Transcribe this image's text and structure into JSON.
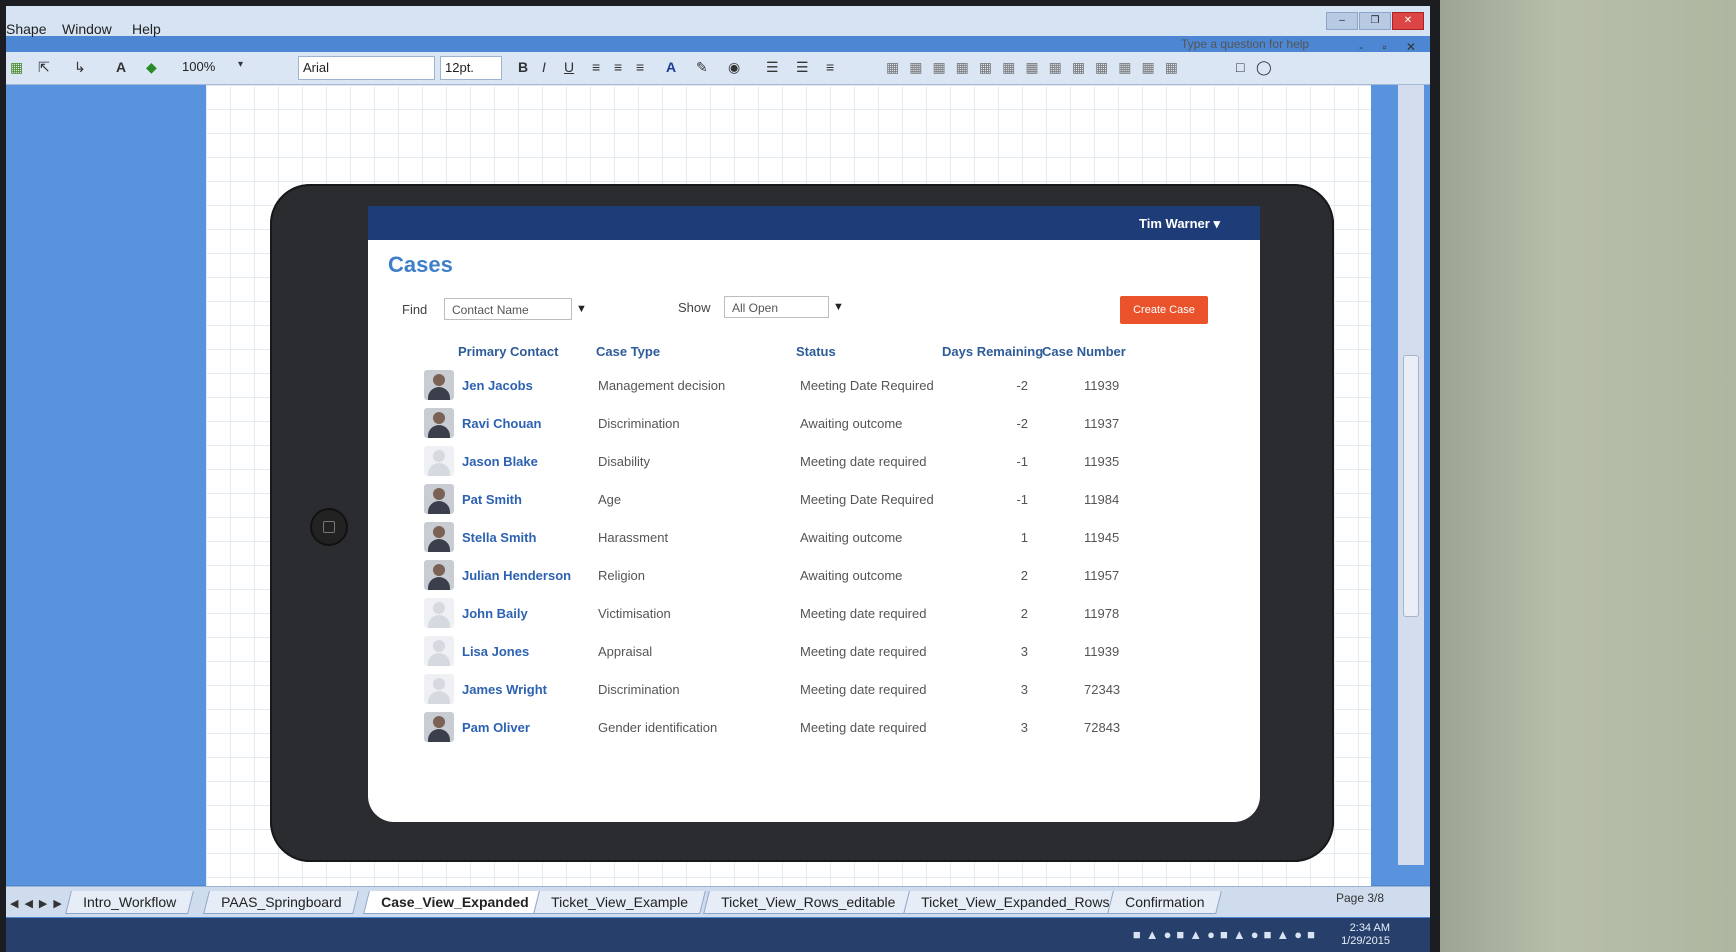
{
  "menubar": {
    "items": [
      "Shape",
      "Window",
      "Help"
    ],
    "help_placeholder": "Type a question for help"
  },
  "toolbar": {
    "zoom": "100%",
    "font": "Arial",
    "font_size": "12pt."
  },
  "app": {
    "user": "Tim Warner",
    "title": "Cases",
    "find_label": "Find",
    "find_value": "Contact Name",
    "show_label": "Show",
    "show_value": "All Open",
    "create_button": "Create Case",
    "columns": [
      "Primary Contact",
      "Case Type",
      "Status",
      "Days Remaining",
      "Case Number"
    ],
    "rows": [
      {
        "name": "Jen Jacobs",
        "type": "Management decision",
        "status": "Meeting Date Required",
        "days": "-2",
        "num": "11939",
        "photo": true
      },
      {
        "name": "Ravi Chouan",
        "type": "Discrimination",
        "status": "Awaiting outcome",
        "days": "-2",
        "num": "11937",
        "photo": true
      },
      {
        "name": "Jason Blake",
        "type": "Disability",
        "status": "Meeting date required",
        "days": "-1",
        "num": "11935",
        "photo": false
      },
      {
        "name": "Pat Smith",
        "type": "Age",
        "status": "Meeting Date Required",
        "days": "-1",
        "num": "11984",
        "photo": true
      },
      {
        "name": "Stella Smith",
        "type": "Harassment",
        "status": "Awaiting outcome",
        "days": "1",
        "num": "11945",
        "photo": true
      },
      {
        "name": "Julian Henderson",
        "type": "Religion",
        "status": "Awaiting outcome",
        "days": "2",
        "num": "11957",
        "photo": true
      },
      {
        "name": "John Baily",
        "type": "Victimisation",
        "status": "Meeting date required",
        "days": "2",
        "num": "11978",
        "photo": false
      },
      {
        "name": "Lisa Jones",
        "type": "Appraisal",
        "status": "Meeting date required",
        "days": "3",
        "num": "11939",
        "photo": false
      },
      {
        "name": "James Wright",
        "type": "Discrimination",
        "status": "Meeting date required",
        "days": "3",
        "num": "72343",
        "photo": false
      },
      {
        "name": "Pam Oliver",
        "type": "Gender identification",
        "status": "Meeting date required",
        "days": "3",
        "num": "72843",
        "photo": true
      }
    ]
  },
  "sheet_tabs": [
    "Intro_Workflow",
    "PAAS_Springboard",
    "Case_View_Expanded",
    "Ticket_View_Example",
    "Ticket_View_Rows_editable",
    "Ticket_View_Expanded_Rows",
    "Confirmation"
  ],
  "active_tab": "Case_View_Expanded",
  "page_indicator": "Page 3/8",
  "taskbar": {
    "time": "2:34 AM",
    "date": "1/29/2015"
  }
}
